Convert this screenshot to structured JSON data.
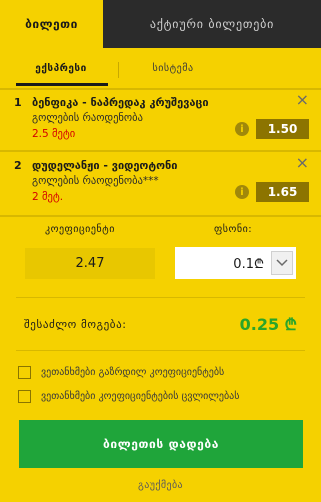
{
  "tabs": {
    "bet_slip": "ბილეთი",
    "active_bets": "აქტიური ბილეთები"
  },
  "subtabs": {
    "express": "ექსპრესი",
    "system": "სისტემა"
  },
  "bets": [
    {
      "number": "1",
      "title": "ბენფიკა - ნაპრედაკ კრუშევაცი",
      "market": "გოლების რაოდენობა",
      "selection": "2.5 მეტი",
      "odds": "1.50"
    },
    {
      "number": "2",
      "title": "დუდელანჟი - ვიდეოტონი",
      "market": "გოლების რაოდენობა***",
      "selection": "2 მეტ.",
      "odds": "1.65"
    }
  ],
  "coefficient": {
    "label": "კოეფიციენტი",
    "value": "2.47"
  },
  "stake": {
    "label": "ფსონი:",
    "value": "0.1₾"
  },
  "possible_win": {
    "label": "შესაძლო მოგება:",
    "value": "0.25 ₾"
  },
  "options": {
    "accept_higher_odds": "ვეთანხმები გაზრდილ კოეფიციენტებს",
    "accept_odds_changes": "ვეთანხმები კოეფიციენტების ცვლილებას"
  },
  "actions": {
    "place_bet": "ბილეთის დადება",
    "clear": "გაუქმება"
  },
  "colors": {
    "accent": "#f5d100",
    "odds_bg": "#8c7400",
    "win_green": "#2aa52a",
    "button_green": "#1fa53a",
    "selection_red": "#d40000"
  }
}
